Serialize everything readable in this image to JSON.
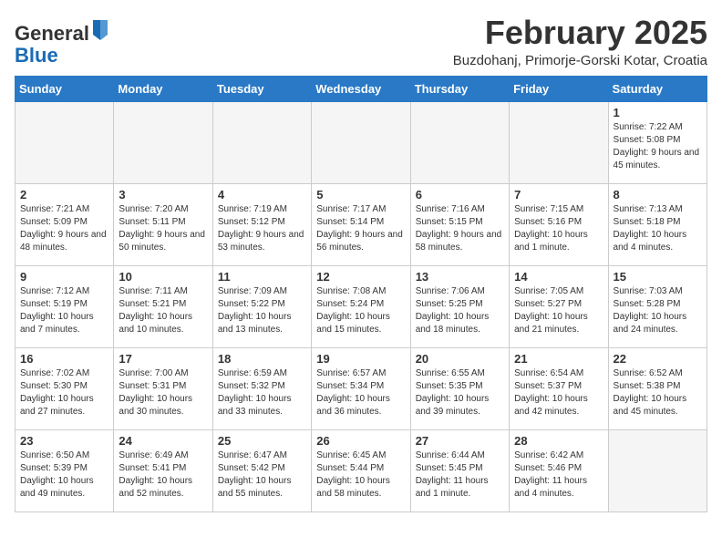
{
  "header": {
    "logo_general": "General",
    "logo_blue": "Blue",
    "title": "February 2025",
    "subtitle": "Buzdohanj, Primorje-Gorski Kotar, Croatia"
  },
  "days_of_week": [
    "Sunday",
    "Monday",
    "Tuesday",
    "Wednesday",
    "Thursday",
    "Friday",
    "Saturday"
  ],
  "weeks": [
    [
      {
        "day": "",
        "info": "",
        "empty": true
      },
      {
        "day": "",
        "info": "",
        "empty": true
      },
      {
        "day": "",
        "info": "",
        "empty": true
      },
      {
        "day": "",
        "info": "",
        "empty": true
      },
      {
        "day": "",
        "info": "",
        "empty": true
      },
      {
        "day": "",
        "info": "",
        "empty": true
      },
      {
        "day": "1",
        "info": "Sunrise: 7:22 AM\nSunset: 5:08 PM\nDaylight: 9 hours and 45 minutes."
      }
    ],
    [
      {
        "day": "2",
        "info": "Sunrise: 7:21 AM\nSunset: 5:09 PM\nDaylight: 9 hours and 48 minutes."
      },
      {
        "day": "3",
        "info": "Sunrise: 7:20 AM\nSunset: 5:11 PM\nDaylight: 9 hours and 50 minutes."
      },
      {
        "day": "4",
        "info": "Sunrise: 7:19 AM\nSunset: 5:12 PM\nDaylight: 9 hours and 53 minutes."
      },
      {
        "day": "5",
        "info": "Sunrise: 7:17 AM\nSunset: 5:14 PM\nDaylight: 9 hours and 56 minutes."
      },
      {
        "day": "6",
        "info": "Sunrise: 7:16 AM\nSunset: 5:15 PM\nDaylight: 9 hours and 58 minutes."
      },
      {
        "day": "7",
        "info": "Sunrise: 7:15 AM\nSunset: 5:16 PM\nDaylight: 10 hours and 1 minute."
      },
      {
        "day": "8",
        "info": "Sunrise: 7:13 AM\nSunset: 5:18 PM\nDaylight: 10 hours and 4 minutes."
      }
    ],
    [
      {
        "day": "9",
        "info": "Sunrise: 7:12 AM\nSunset: 5:19 PM\nDaylight: 10 hours and 7 minutes."
      },
      {
        "day": "10",
        "info": "Sunrise: 7:11 AM\nSunset: 5:21 PM\nDaylight: 10 hours and 10 minutes."
      },
      {
        "day": "11",
        "info": "Sunrise: 7:09 AM\nSunset: 5:22 PM\nDaylight: 10 hours and 13 minutes."
      },
      {
        "day": "12",
        "info": "Sunrise: 7:08 AM\nSunset: 5:24 PM\nDaylight: 10 hours and 15 minutes."
      },
      {
        "day": "13",
        "info": "Sunrise: 7:06 AM\nSunset: 5:25 PM\nDaylight: 10 hours and 18 minutes."
      },
      {
        "day": "14",
        "info": "Sunrise: 7:05 AM\nSunset: 5:27 PM\nDaylight: 10 hours and 21 minutes."
      },
      {
        "day": "15",
        "info": "Sunrise: 7:03 AM\nSunset: 5:28 PM\nDaylight: 10 hours and 24 minutes."
      }
    ],
    [
      {
        "day": "16",
        "info": "Sunrise: 7:02 AM\nSunset: 5:30 PM\nDaylight: 10 hours and 27 minutes."
      },
      {
        "day": "17",
        "info": "Sunrise: 7:00 AM\nSunset: 5:31 PM\nDaylight: 10 hours and 30 minutes."
      },
      {
        "day": "18",
        "info": "Sunrise: 6:59 AM\nSunset: 5:32 PM\nDaylight: 10 hours and 33 minutes."
      },
      {
        "day": "19",
        "info": "Sunrise: 6:57 AM\nSunset: 5:34 PM\nDaylight: 10 hours and 36 minutes."
      },
      {
        "day": "20",
        "info": "Sunrise: 6:55 AM\nSunset: 5:35 PM\nDaylight: 10 hours and 39 minutes."
      },
      {
        "day": "21",
        "info": "Sunrise: 6:54 AM\nSunset: 5:37 PM\nDaylight: 10 hours and 42 minutes."
      },
      {
        "day": "22",
        "info": "Sunrise: 6:52 AM\nSunset: 5:38 PM\nDaylight: 10 hours and 45 minutes."
      }
    ],
    [
      {
        "day": "23",
        "info": "Sunrise: 6:50 AM\nSunset: 5:39 PM\nDaylight: 10 hours and 49 minutes."
      },
      {
        "day": "24",
        "info": "Sunrise: 6:49 AM\nSunset: 5:41 PM\nDaylight: 10 hours and 52 minutes."
      },
      {
        "day": "25",
        "info": "Sunrise: 6:47 AM\nSunset: 5:42 PM\nDaylight: 10 hours and 55 minutes."
      },
      {
        "day": "26",
        "info": "Sunrise: 6:45 AM\nSunset: 5:44 PM\nDaylight: 10 hours and 58 minutes."
      },
      {
        "day": "27",
        "info": "Sunrise: 6:44 AM\nSunset: 5:45 PM\nDaylight: 11 hours and 1 minute."
      },
      {
        "day": "28",
        "info": "Sunrise: 6:42 AM\nSunset: 5:46 PM\nDaylight: 11 hours and 4 minutes."
      },
      {
        "day": "",
        "info": "",
        "empty": true
      }
    ]
  ]
}
